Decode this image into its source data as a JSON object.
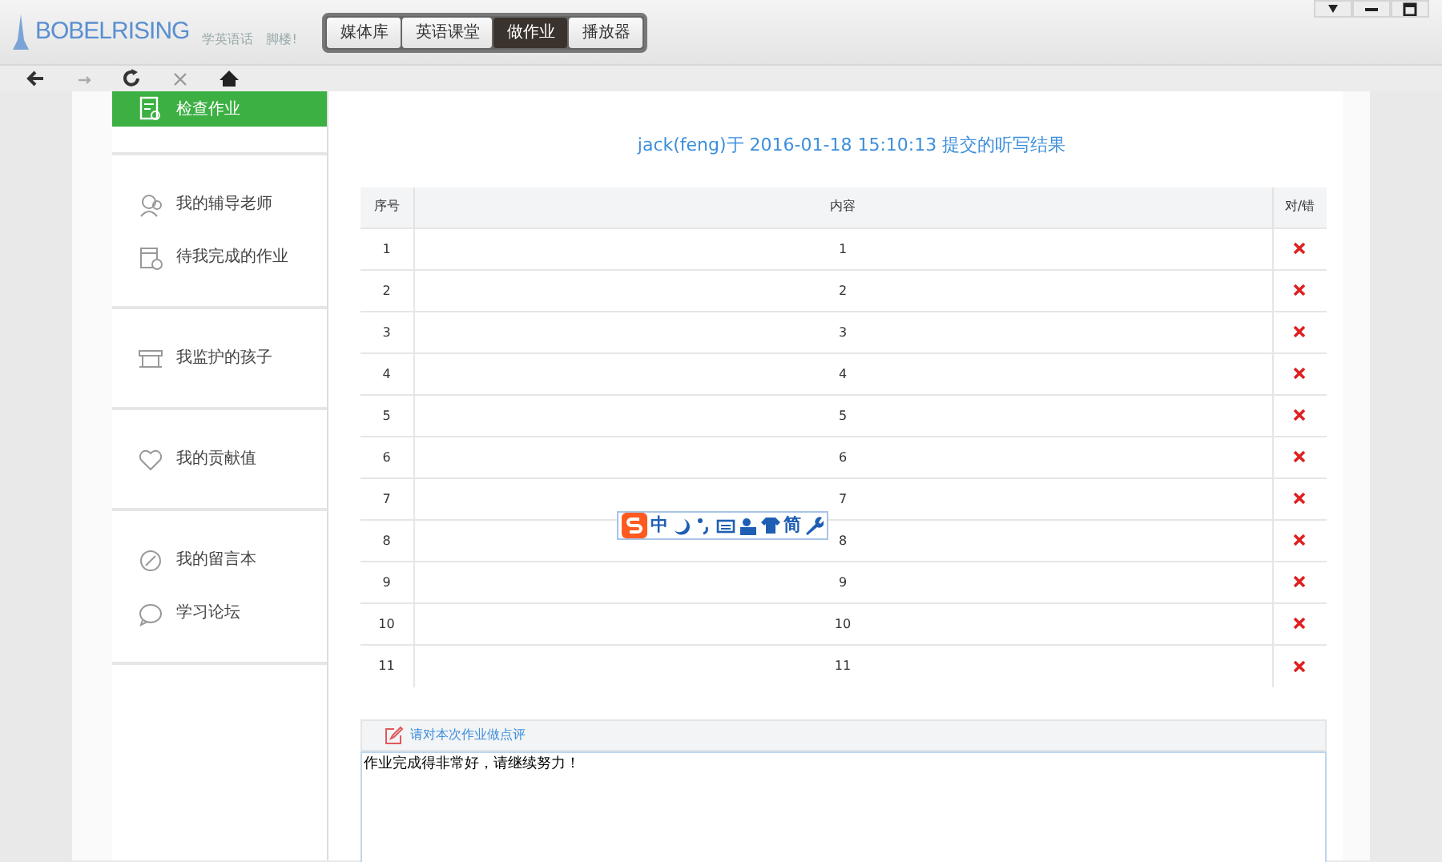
{
  "app": {
    "logo": "BOBELRISING",
    "slogan": "学英语话",
    "slogan_2": "脚楼!"
  },
  "tabs": [
    {
      "label": "媒体库",
      "selected": false
    },
    {
      "label": "英语课堂",
      "selected": false
    },
    {
      "label": "做作业",
      "selected": true
    },
    {
      "label": "播放器",
      "selected": false
    }
  ],
  "sidebar": {
    "groups": [
      [
        {
          "label": "检查作业",
          "kind": "doc",
          "selected": true
        }
      ],
      [
        {
          "label": "我的辅导老师",
          "kind": "people",
          "selected": false
        },
        {
          "label": "待我完成的作业",
          "kind": "calendar",
          "selected": false
        }
      ],
      [
        {
          "label": "我监护的孩子",
          "kind": "store",
          "selected": false
        }
      ],
      [
        {
          "label": "我的贡献值",
          "kind": "heart",
          "selected": false
        }
      ],
      [
        {
          "label": "我的留言本",
          "kind": "pen",
          "selected": false
        },
        {
          "label": "学习论坛",
          "kind": "chat",
          "selected": false
        }
      ]
    ]
  },
  "title": "jack(feng)于 2016-01-18 15:10:13 提交的听写结果",
  "table": {
    "columns": [
      "序号",
      "内容",
      "对/错"
    ],
    "rows": [
      {
        "index": "1",
        "content": "1",
        "correct": false
      },
      {
        "index": "2",
        "content": "2",
        "correct": false
      },
      {
        "index": "3",
        "content": "3",
        "correct": false
      },
      {
        "index": "4",
        "content": "4",
        "correct": false
      },
      {
        "index": "5",
        "content": "5",
        "correct": false
      },
      {
        "index": "6",
        "content": "6",
        "correct": false
      },
      {
        "index": "7",
        "content": "7",
        "correct": false
      },
      {
        "index": "8",
        "content": "8",
        "correct": false
      },
      {
        "index": "9",
        "content": "9",
        "correct": false
      },
      {
        "index": "10",
        "content": "10",
        "correct": false
      },
      {
        "index": "11",
        "content": "11",
        "correct": false
      }
    ]
  },
  "comment": {
    "label": "请对本次作业做点评",
    "value": "作业完成得非常好，请继续努力！"
  },
  "ime_toolbar": {
    "mode": "中",
    "script": "简"
  }
}
